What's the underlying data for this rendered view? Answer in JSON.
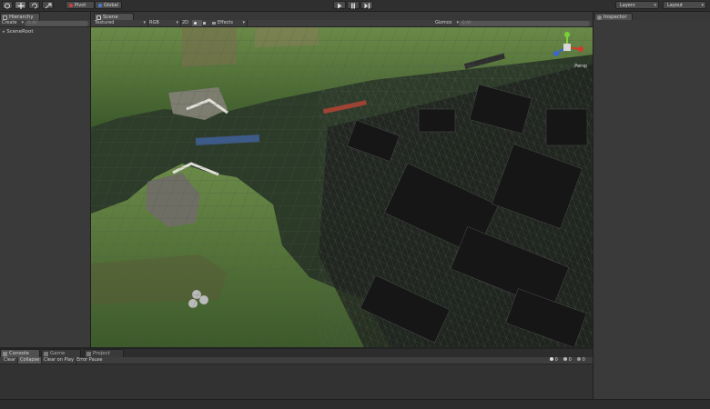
{
  "toolbar": {
    "pivot_label": "Pivot",
    "global_label": "Global",
    "layers_label": "Layers",
    "layout_label": "Layout",
    "tool_icons": [
      "hand-icon",
      "move-icon",
      "rotate-icon",
      "scale-icon"
    ],
    "play_icons": [
      "play-icon",
      "pause-icon",
      "step-icon"
    ]
  },
  "hierarchy": {
    "tab_label": "Hierarchy",
    "create_label": "Create",
    "search_placeholder": "Q:All",
    "items": [
      "SceneRoot"
    ]
  },
  "scene": {
    "tab_label": "Scene",
    "shading_mode": "Textured",
    "render_mode": "RGB",
    "toggle_2d": "2D",
    "effects_label": "Effects",
    "gizmos_label": "Gizmos",
    "search_placeholder": "Q:All",
    "projection_label": "Persp"
  },
  "inspector": {
    "tab_label": "Inspector"
  },
  "bottom": {
    "tabs": [
      "Console",
      "Game",
      "Project"
    ],
    "buttons": [
      "Clear",
      "Collapse",
      "Clear on Play",
      "Error Pause"
    ],
    "counts": [
      "0",
      "0",
      "0"
    ]
  },
  "colors": {
    "accent": "#4a7bd0",
    "gizmo_x": "#d03a2b",
    "gizmo_y": "#7bd03a",
    "gizmo_z": "#3a66d0"
  }
}
